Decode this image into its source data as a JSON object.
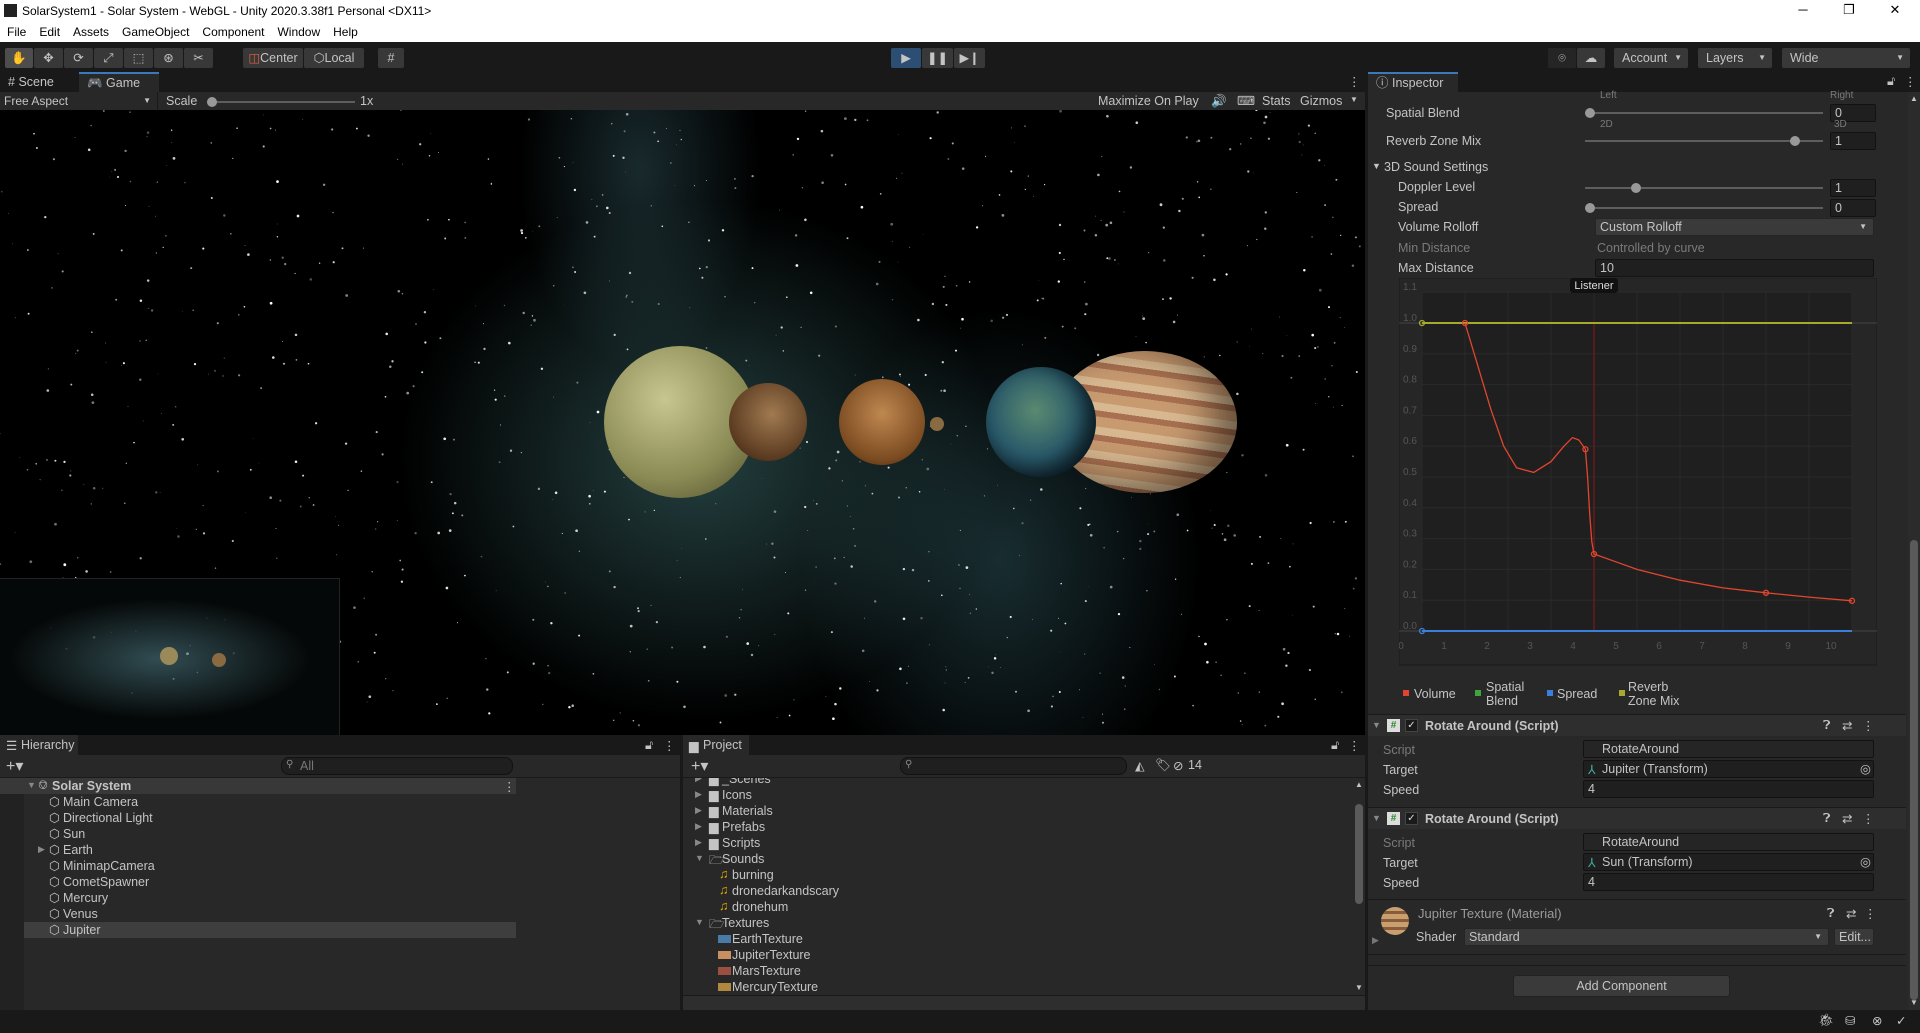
{
  "window": {
    "title": "SolarSystem1 - Solar System - WebGL - Unity 2020.3.38f1 Personal <DX11>",
    "controls": [
      "─",
      "❐",
      "✕"
    ]
  },
  "menu": [
    "File",
    "Edit",
    "Assets",
    "GameObject",
    "Component",
    "Window",
    "Help"
  ],
  "toolbar": {
    "tools": [
      "hand-tool",
      "move-tool",
      "rotate-tool",
      "scale-tool",
      "rect-tool",
      "transform-tool",
      "custom-tool"
    ],
    "pivot_mode": "Center",
    "pivot_rotation": "Local",
    "account": "Account",
    "layers": "Layers",
    "layout": "Wide",
    "play_active": true,
    "accent": "#2d4e73"
  },
  "game": {
    "tabs": [
      "Scene",
      "Game"
    ],
    "active_tab": "Game",
    "aspect": "Free Aspect",
    "scale_label": "Scale",
    "scale_value": "1x",
    "maximize": "Maximize On Play",
    "stats": "Stats",
    "gizmos": "Gizmos"
  },
  "hierarchy": {
    "tab": "Hierarchy",
    "search_placeholder": "All",
    "scene": "Solar System",
    "items": [
      {
        "name": "Main Camera"
      },
      {
        "name": "Directional Light"
      },
      {
        "name": "Sun"
      },
      {
        "name": "Earth",
        "expandable": true
      },
      {
        "name": "MinimapCamera"
      },
      {
        "name": "CometSpawner"
      },
      {
        "name": "Mercury"
      },
      {
        "name": "Venus"
      },
      {
        "name": "Jupiter",
        "selected": true
      }
    ]
  },
  "project": {
    "tab": "Project",
    "hidden_count": "14",
    "items": [
      {
        "name": "_Scenes",
        "type": "folder",
        "depth": 0
      },
      {
        "name": "Icons",
        "type": "folder",
        "depth": 0
      },
      {
        "name": "Materials",
        "type": "folder",
        "depth": 0
      },
      {
        "name": "Prefabs",
        "type": "folder",
        "depth": 0
      },
      {
        "name": "Scripts",
        "type": "folder",
        "depth": 0
      },
      {
        "name": "Sounds",
        "type": "folder-open",
        "depth": 0
      },
      {
        "name": "burning",
        "type": "audio",
        "depth": 1
      },
      {
        "name": "dronedarkandscary",
        "type": "audio",
        "depth": 1
      },
      {
        "name": "dronehum",
        "type": "audio",
        "depth": 1
      },
      {
        "name": "Textures",
        "type": "folder-open",
        "depth": 0
      },
      {
        "name": "EarthTexture",
        "type": "texture",
        "depth": 1,
        "color": "#4a7aa8"
      },
      {
        "name": "JupiterTexture",
        "type": "texture",
        "depth": 1,
        "color": "#c89060"
      },
      {
        "name": "MarsTexture",
        "type": "texture",
        "depth": 1,
        "color": "#9a5040"
      },
      {
        "name": "MercuryTexture",
        "type": "texture",
        "depth": 1,
        "color": "#b08840"
      }
    ]
  },
  "inspector": {
    "tab": "Inspector",
    "pan_left": "Left",
    "pan_right": "Right",
    "spatial_blend": {
      "label": "Spatial Blend",
      "value": "0",
      "min": "2D",
      "max": "3D",
      "fraction": 0
    },
    "reverb": {
      "label": "Reverb Zone Mix",
      "value": "1",
      "fraction": 0.9
    },
    "sound3d": "3D Sound Settings",
    "doppler": {
      "label": "Doppler Level",
      "value": "1",
      "fraction": 0.2
    },
    "spread": {
      "label": "Spread",
      "value": "0",
      "fraction": 0
    },
    "rolloff": {
      "label": "Volume Rolloff",
      "value": "Custom Rolloff"
    },
    "min_distance": {
      "label": "Min Distance",
      "value": "Controlled by curve"
    },
    "max_distance": {
      "label": "Max Distance",
      "value": "10"
    },
    "components": [
      {
        "title": "Rotate Around (Script)",
        "script_label": "Script",
        "script": "RotateAround",
        "target_label": "Target",
        "target": "Jupiter (Transform)",
        "speed_label": "Speed",
        "speed": "4"
      },
      {
        "title": "Rotate Around (Script)",
        "script_label": "Script",
        "script": "RotateAround",
        "target_label": "Target",
        "target": "Sun (Transform)",
        "speed_label": "Speed",
        "speed": "4"
      }
    ],
    "material": {
      "title": "Jupiter Texture (Material)",
      "shader_label": "Shader",
      "shader": "Standard",
      "edit": "Edit..."
    },
    "add_component": "Add Component"
  },
  "chart_data": {
    "type": "line",
    "annotation": "Listener",
    "x_ticks": [
      "0",
      "1",
      "2",
      "3",
      "4",
      "5",
      "6",
      "7",
      "8",
      "9",
      "10"
    ],
    "y_ticks": [
      "0.0",
      "0.1",
      "0.2",
      "0.3",
      "0.4",
      "0.5",
      "0.6",
      "0.7",
      "0.8",
      "0.9",
      "1.0",
      "1.1"
    ],
    "xlim": [
      0,
      10
    ],
    "ylim": [
      0,
      1.1
    ],
    "listener_x": 4.0,
    "legend_placement": "bottom",
    "series": [
      {
        "name": "Volume",
        "color": "#e0462e",
        "keys": [
          [
            1.0,
            1.0
          ],
          [
            3.8,
            0.59
          ],
          [
            4.0,
            0.25
          ],
          [
            8.0,
            0.124
          ],
          [
            10.0,
            0.098
          ]
        ],
        "curve": [
          [
            1.0,
            1.0
          ],
          [
            1.3,
            0.86
          ],
          [
            1.6,
            0.72
          ],
          [
            1.9,
            0.6
          ],
          [
            2.2,
            0.53
          ],
          [
            2.6,
            0.515
          ],
          [
            3.0,
            0.55
          ],
          [
            3.3,
            0.6
          ],
          [
            3.5,
            0.628
          ],
          [
            3.65,
            0.62
          ],
          [
            3.8,
            0.59
          ],
          [
            3.85,
            0.5
          ],
          [
            3.9,
            0.38
          ],
          [
            3.95,
            0.29
          ],
          [
            4.0,
            0.25
          ],
          [
            4.5,
            0.225
          ],
          [
            5.0,
            0.2
          ],
          [
            6.0,
            0.165
          ],
          [
            7.0,
            0.14
          ],
          [
            8.0,
            0.124
          ],
          [
            9.0,
            0.11
          ],
          [
            10.0,
            0.098
          ]
        ]
      },
      {
        "name": "Spatial Blend",
        "color": "#3ea43e",
        "keys": []
      },
      {
        "name": "Spread",
        "color": "#3a7fdb",
        "keys": [
          [
            0,
            0
          ]
        ],
        "curve": [
          [
            0,
            0
          ],
          [
            10,
            0
          ]
        ]
      },
      {
        "name": "Reverb Zone Mix",
        "color": "#a8a82c",
        "keys": [
          [
            0,
            1
          ]
        ],
        "curve": [
          [
            0,
            1
          ],
          [
            10,
            1
          ]
        ]
      }
    ]
  }
}
